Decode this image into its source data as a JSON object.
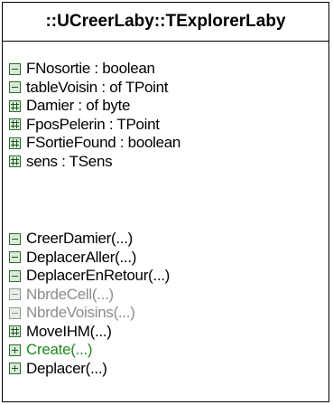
{
  "class": {
    "title": "::UCreerLaby::TExplorerLaby"
  },
  "attributes": [
    {
      "text": "FNosortie : boolean",
      "visibility": "private",
      "color": "#000000"
    },
    {
      "text": "tableVoisin : of TPoint",
      "visibility": "private",
      "color": "#000000"
    },
    {
      "text": "Damier : of byte",
      "visibility": "protected",
      "color": "#000000"
    },
    {
      "text": "FposPelerin : TPoint",
      "visibility": "protected",
      "color": "#000000"
    },
    {
      "text": "FSortieFound : boolean",
      "visibility": "protected",
      "color": "#000000"
    },
    {
      "text": "sens : TSens",
      "visibility": "protected",
      "color": "#000000"
    }
  ],
  "operations": [
    {
      "text": "CreerDamier(...)",
      "visibility": "private",
      "color": "#000000"
    },
    {
      "text": "DeplacerAller(...)",
      "visibility": "private",
      "color": "#000000"
    },
    {
      "text": "DeplacerEnRetour(...)",
      "visibility": "private",
      "color": "#000000"
    },
    {
      "text": "NbrdeCell(...)",
      "visibility": "private",
      "color": "#8c8c8c"
    },
    {
      "text": "NbrdeVoisins(...)",
      "visibility": "private",
      "color": "#8c8c8c"
    },
    {
      "text": "MoveIHM(...)",
      "visibility": "protected",
      "color": "#000000"
    },
    {
      "text": "Create(...)",
      "visibility": "public",
      "color": "#1f8a1f"
    },
    {
      "text": "Deplacer(...)",
      "visibility": "public",
      "color": "#000000"
    }
  ]
}
